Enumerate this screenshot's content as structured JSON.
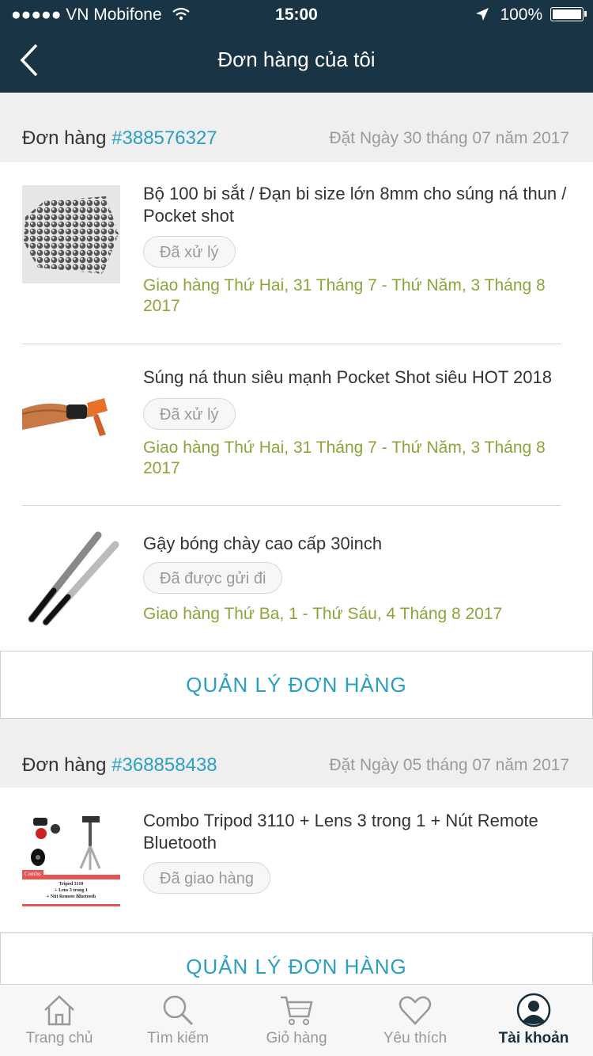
{
  "status_bar": {
    "carrier": "●●●●● VN Mobifone",
    "time": "15:00",
    "battery": "100%"
  },
  "header": {
    "title": "Đơn hàng của tôi"
  },
  "orders": [
    {
      "label": "Đơn hàng",
      "number": "#388576327",
      "date": "Đặt Ngày 30 tháng 07 năm 2017",
      "items": [
        {
          "name": "Bộ 100 bi sắt / Đạn bi size lớn 8mm cho súng ná thun / Pocket shot",
          "status": "Đã xử lý",
          "shipping": "Giao hàng Thứ Hai, 31 Tháng 7 - Thứ Năm, 3 Tháng 8 2017"
        },
        {
          "name": "Súng ná thun siêu mạnh Pocket Shot siêu HOT 2018",
          "status": "Đã xử lý",
          "shipping": "Giao hàng Thứ Hai, 31 Tháng 7 - Thứ Năm, 3 Tháng 8 2017"
        },
        {
          "name": "Gậy bóng chày cao cấp 30inch",
          "status": "Đã được gửi đi",
          "shipping": "Giao hàng Thứ Ba, 1 - Thứ Sáu, 4 Tháng 8 2017"
        }
      ],
      "manage_label": "QUẢN LÝ ĐƠN HÀNG"
    },
    {
      "label": "Đơn hàng",
      "number": "#368858438",
      "date": "Đặt Ngày 05 tháng 07 năm 2017",
      "items": [
        {
          "name": "Combo Tripod 3110 + Lens 3 trong 1 + Nút Remote Bluetooth",
          "status": "Đã giao hàng",
          "thumb_text": {
            "tag": "Combo",
            "line1": "Tripod 3110",
            "line2": "+ Lens 3 trong 1",
            "line3": "+ Nút Remote Bluetooth"
          }
        }
      ],
      "manage_label": "QUẢN LÝ ĐƠN HÀNG"
    }
  ],
  "tabbar": {
    "items": [
      {
        "label": "Trang chủ",
        "icon": "home-icon"
      },
      {
        "label": "Tìm kiếm",
        "icon": "search-icon"
      },
      {
        "label": "Giỏ hàng",
        "icon": "cart-icon"
      },
      {
        "label": "Yêu thích",
        "icon": "heart-icon"
      },
      {
        "label": "Tài khoản",
        "icon": "account-icon"
      }
    ],
    "active": "Tài khoản"
  },
  "colors": {
    "header_bg": "#193545",
    "accent": "#2a9fc4",
    "shipping": "#8aa63a"
  }
}
